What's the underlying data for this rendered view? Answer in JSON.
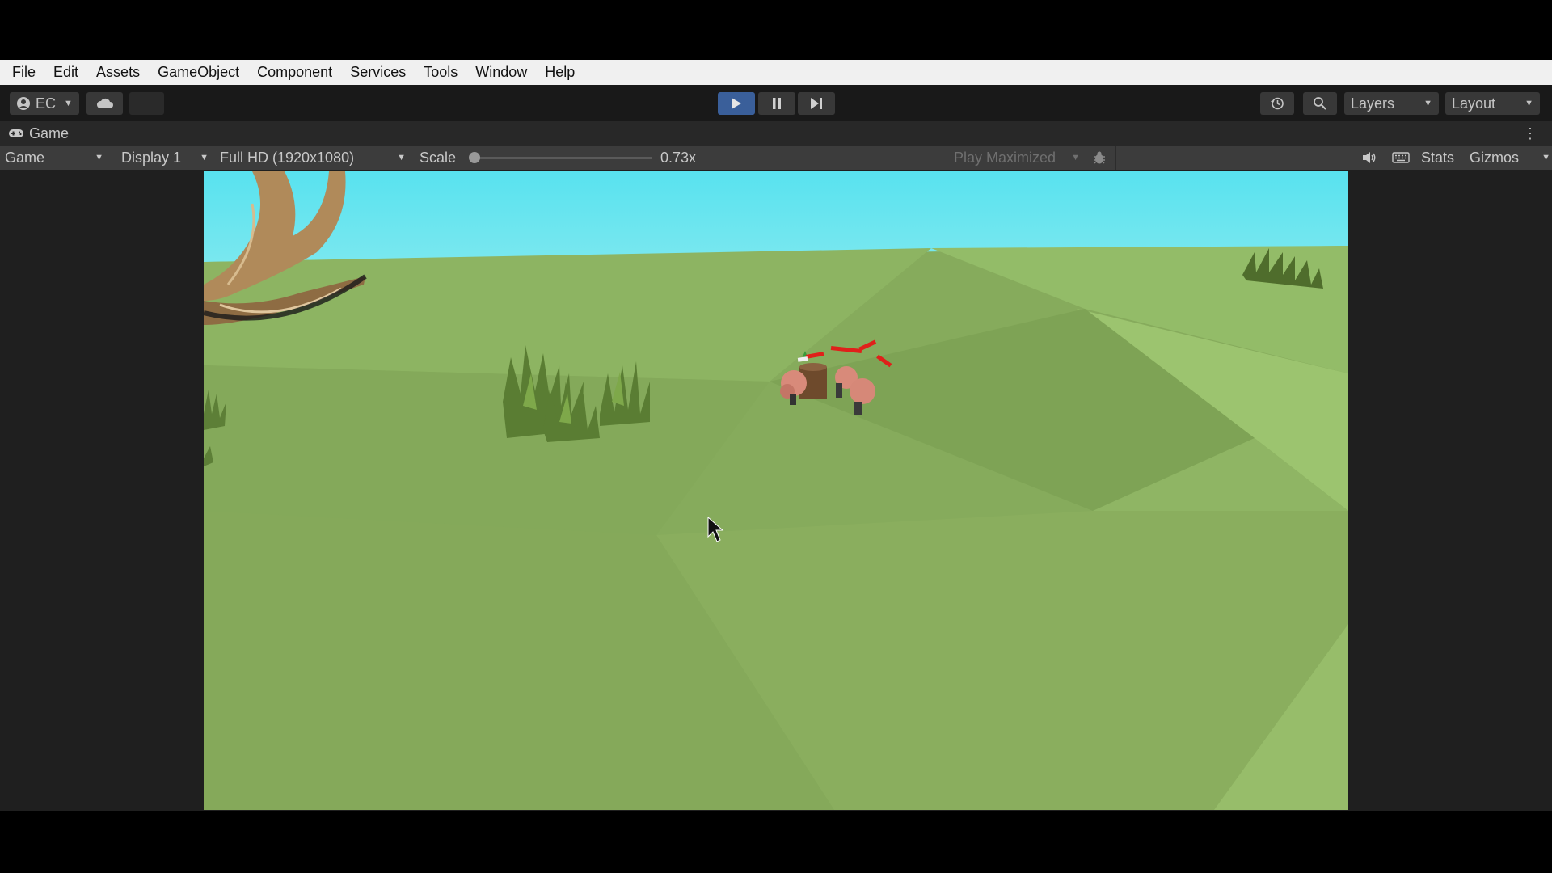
{
  "menu": [
    "File",
    "Edit",
    "Assets",
    "GameObject",
    "Component",
    "Services",
    "Tools",
    "Window",
    "Help"
  ],
  "toolbar": {
    "account_label": "EC",
    "account_icon": "user-circle-icon",
    "cloud_icon": "cloud-icon",
    "play_icon": "play-icon",
    "pause_icon": "pause-icon",
    "step_icon": "step-icon",
    "history_icon": "history-icon",
    "search_icon": "search-icon",
    "layers_label": "Layers",
    "layout_label": "Layout",
    "play_active_color": "#3a5f9a"
  },
  "tab": {
    "label": "Game",
    "icon": "gamepad-icon"
  },
  "game_toolbar": {
    "view_label": "Game",
    "display_label": "Display 1",
    "resolution_label": "Full HD (1920x1080)",
    "scale_label": "Scale",
    "scale_value": "0.73x",
    "play_maximized_label": "Play Maximized",
    "stats_label": "Stats",
    "gizmos_label": "Gizmos"
  },
  "scene": {
    "sky_color": "#5fe3ee",
    "ground_color": "#86ab5c"
  }
}
